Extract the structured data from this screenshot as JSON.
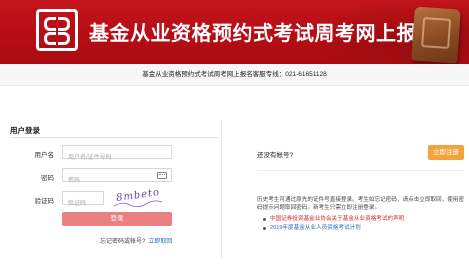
{
  "banner": {
    "title": "基金从业资格预约式考试周考网上报名"
  },
  "hotline": "基金从业资格预约式考试周考网上报名客服专线：021-61651128",
  "login": {
    "section_title": "用户登录",
    "username_label": "用户名",
    "username_placeholder": "用户名/证件号码",
    "password_label": "密码",
    "password_placeholder": "密码",
    "captcha_label": "验证码",
    "captcha_placeholder": "验证码",
    "captcha_text": "8mbeto",
    "login_button": "登录",
    "forgot_text": "忘记密码或帐号?",
    "forgot_link": "立即取回"
  },
  "register": {
    "no_account_text": "还没有帐号?",
    "register_button": "立即注册",
    "note": "历史考生可通过原先的证件号直接登录。考生如忘记密码，请点击立即取回，使用密码提示问题取回密码。新考生只需立即注册登录。",
    "notices": [
      {
        "text": "中国证券投资基金业协会关于基金从业资格考试的声明",
        "color": "red"
      },
      {
        "text": "2019年度基金从业人员资格考试计划",
        "color": "blue"
      }
    ]
  },
  "colors": {
    "banner_red": "#b50d14",
    "login_button": "#e8817f",
    "register_button": "#f3a33d",
    "link_blue": "#2a6fbf"
  }
}
